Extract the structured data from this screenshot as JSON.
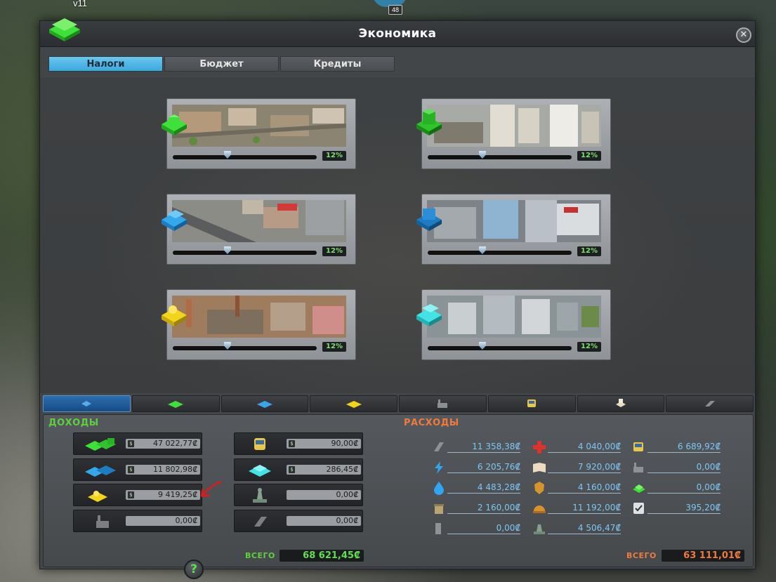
{
  "hud": {
    "version": "v11",
    "badge_count": "48"
  },
  "window": {
    "title": "Экономика",
    "close_label": "✕"
  },
  "tabs": [
    {
      "label": "Налоги",
      "active": true
    },
    {
      "label": "Бюджет",
      "active": false
    },
    {
      "label": "Кредиты",
      "active": false
    }
  ],
  "tax_panels": [
    {
      "zone": "residential-low",
      "icon": "residential-low-icon",
      "icon_color": "#3fe03a",
      "rate": "12%",
      "slider_fraction": 0.38
    },
    {
      "zone": "residential-high",
      "icon": "residential-high-icon",
      "icon_color": "#27b226",
      "rate": "12%",
      "slider_fraction": 0.38
    },
    {
      "zone": "commercial-low",
      "icon": "commercial-low-icon",
      "icon_color": "#34a8ea",
      "rate": "12%",
      "slider_fraction": 0.38
    },
    {
      "zone": "commercial-high",
      "icon": "commercial-high-icon",
      "icon_color": "#1e7cc2",
      "rate": "12%",
      "slider_fraction": 0.38
    },
    {
      "zone": "industrial",
      "icon": "industrial-icon",
      "icon_color": "#f2d51a",
      "rate": "12%",
      "slider_fraction": 0.38
    },
    {
      "zone": "office",
      "icon": "office-icon",
      "icon_color": "#43e2e4",
      "rate": "12%",
      "slider_fraction": 0.38
    }
  ],
  "category_tabs": [
    "all-icon",
    "residential-icon",
    "commercial-icon",
    "industrial-icon",
    "office-icon",
    "transport-icon",
    "tourism-icon",
    "other-icon"
  ],
  "income": {
    "title": "ДОХОДЫ",
    "items": [
      {
        "icon": "residential-icon",
        "value": "47 022,77₡"
      },
      {
        "icon": "commercial-icon",
        "value": "11 802,98₡"
      },
      {
        "icon": "industrial-icon",
        "value": "9 419,25₡"
      },
      {
        "icon": "factory-icon",
        "value": "0,00₡"
      },
      {
        "icon": "bus-icon",
        "value": "90,00₡"
      },
      {
        "icon": "office-icon",
        "value": "286,45₡"
      },
      {
        "icon": "monument-icon",
        "value": "0,00₡"
      },
      {
        "icon": "road-icon",
        "value": "0,00₡"
      }
    ],
    "total_label": "ВСЕГО",
    "total_value": "68 621,45₡"
  },
  "expenses": {
    "title": "РАСХОДЫ",
    "items": [
      {
        "icon": "road-icon",
        "value": "11 358,38₡"
      },
      {
        "icon": "electricity-icon",
        "value": "6 205,76₡"
      },
      {
        "icon": "water-icon",
        "value": "4 483,28₡"
      },
      {
        "icon": "garbage-icon",
        "value": "2 160,00₡"
      },
      {
        "icon": "monument-icon",
        "value": "0,00₡"
      },
      {
        "icon": "health-icon",
        "value": "4 040,00₡"
      },
      {
        "icon": "education-icon",
        "value": "7 920,00₡"
      },
      {
        "icon": "police-icon",
        "value": "4 160,00₡"
      },
      {
        "icon": "fire-icon",
        "value": "11 192,00₡"
      },
      {
        "icon": "park-icon",
        "value": "4 506,47₡"
      },
      {
        "icon": "bus-icon",
        "value": "6 689,92₡"
      },
      {
        "icon": "factory-icon",
        "value": "0,00₡"
      },
      {
        "icon": "money-icon",
        "value": "0,00₡"
      },
      {
        "icon": "policy-icon",
        "value": "395,20₡"
      }
    ],
    "total_label": "ВСЕГО",
    "total_value": "63 111,01₡"
  },
  "help_label": "?",
  "colors": {
    "income": "#5fcf3f",
    "expense": "#f07a3c",
    "accent": "#3aa7dc"
  }
}
